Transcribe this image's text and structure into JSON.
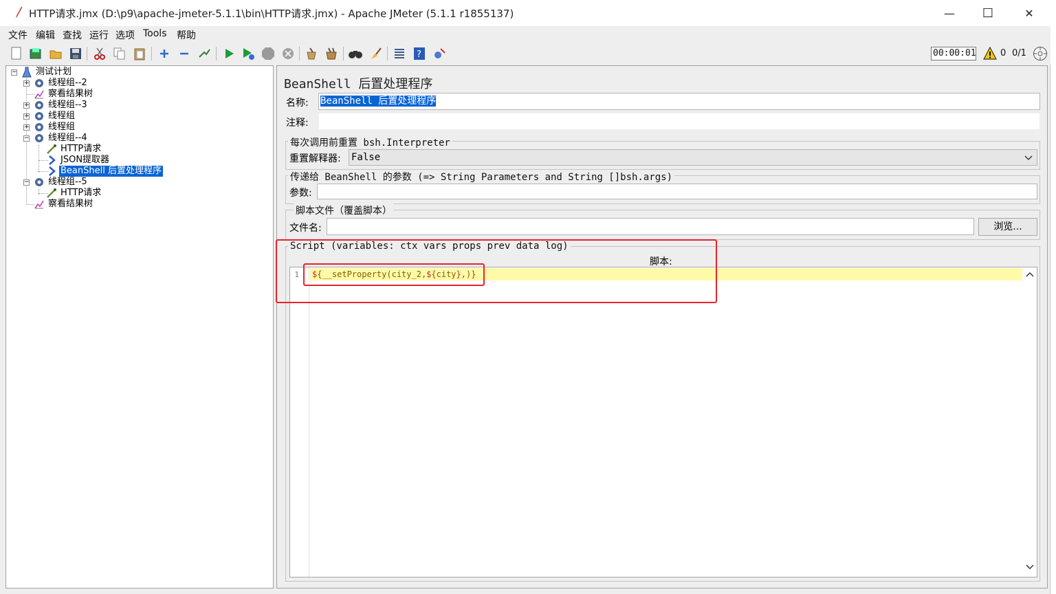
{
  "window": {
    "title": "HTTP请求.jmx (D:\\p9\\apache-jmeter-5.1.1\\bin\\HTTP请求.jmx) - Apache JMeter (5.1.1 r1855137)",
    "minimize": "—",
    "maximize": "☐",
    "close": "✕"
  },
  "menu": [
    "文件",
    "编辑",
    "查找",
    "运行",
    "选项",
    "Tools",
    "帮助"
  ],
  "toolbar": {
    "timer": "00:00:01",
    "error_count": "0",
    "thread_count": "0/1"
  },
  "tree": {
    "nodes": [
      {
        "label": "测试计划",
        "icon": "test-plan-icon"
      },
      {
        "label": "线程组--2",
        "icon": "thread-group-icon"
      },
      {
        "label": "察看结果树",
        "icon": "results-tree-icon"
      },
      {
        "label": "线程组--3",
        "icon": "thread-group-icon"
      },
      {
        "label": "线程组",
        "icon": "thread-group-icon"
      },
      {
        "label": "线程组",
        "icon": "thread-group-icon"
      },
      {
        "label": "线程组--4",
        "icon": "thread-group-icon"
      },
      {
        "label": "HTTP请求",
        "icon": "http-sampler-icon"
      },
      {
        "label": "JSON提取器",
        "icon": "post-processor-icon"
      },
      {
        "label": "BeanShell 后置处理程序",
        "icon": "post-processor-icon"
      },
      {
        "label": "线程组--5",
        "icon": "thread-group-icon"
      },
      {
        "label": "HTTP请求",
        "icon": "http-sampler-icon"
      },
      {
        "label": "察看结果树",
        "icon": "results-tree-icon"
      }
    ]
  },
  "panel": {
    "title": "BeanShell 后置处理程序",
    "name_label": "名称:",
    "name_value": "BeanShell 后置处理程序",
    "comment_label": "注释:",
    "comment_value": "",
    "reset_section": "每次调用前重置 bsh.Interpreter",
    "reset_label": "重置解释器:",
    "reset_value": "False",
    "params_section": "传递给 BeanShell 的参数 (=> String Parameters and String []bsh.args)",
    "params_label": "参数:",
    "params_value": "",
    "file_section": "脚本文件（覆盖脚本）",
    "file_label": "文件名:",
    "file_value": "",
    "browse": "浏览...",
    "script_section": "Script (variables: ctx vars props prev data log)",
    "script_label": "脚本:",
    "line_number": "1",
    "code": {
      "p1": "${",
      "p2": "__setProperty(city_2,",
      "p3": "${",
      "p4": "city",
      "p5": "}",
      "p6": ",)",
      "p7": "}"
    }
  },
  "colors": {
    "selection": "#0a64d4",
    "highlight_line": "#fffaa8",
    "annotation": "#e8232b",
    "code_brace": "#c03020",
    "code_function": "#806000"
  }
}
